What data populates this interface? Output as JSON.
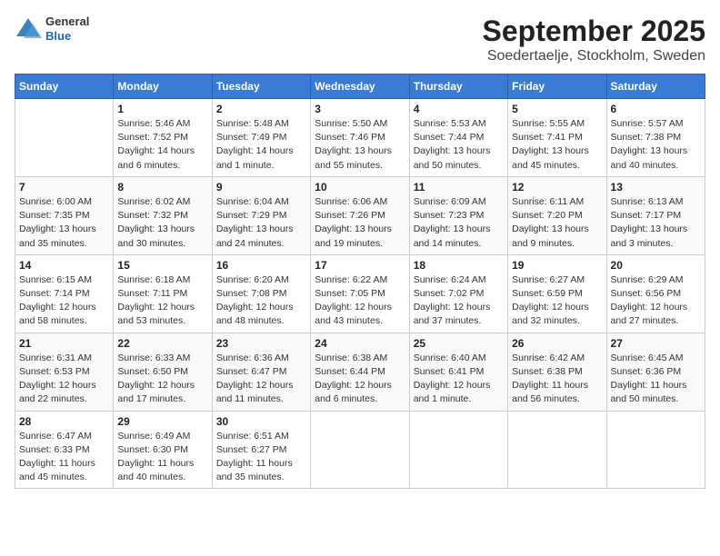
{
  "header": {
    "logo_line1": "General",
    "logo_line2": "Blue",
    "title": "September 2025",
    "subtitle": "Soedertaelje, Stockholm, Sweden"
  },
  "weekdays": [
    "Sunday",
    "Monday",
    "Tuesday",
    "Wednesday",
    "Thursday",
    "Friday",
    "Saturday"
  ],
  "weeks": [
    [
      {
        "day": "",
        "info": ""
      },
      {
        "day": "1",
        "info": "Sunrise: 5:46 AM\nSunset: 7:52 PM\nDaylight: 14 hours\nand 6 minutes."
      },
      {
        "day": "2",
        "info": "Sunrise: 5:48 AM\nSunset: 7:49 PM\nDaylight: 14 hours\nand 1 minute."
      },
      {
        "day": "3",
        "info": "Sunrise: 5:50 AM\nSunset: 7:46 PM\nDaylight: 13 hours\nand 55 minutes."
      },
      {
        "day": "4",
        "info": "Sunrise: 5:53 AM\nSunset: 7:44 PM\nDaylight: 13 hours\nand 50 minutes."
      },
      {
        "day": "5",
        "info": "Sunrise: 5:55 AM\nSunset: 7:41 PM\nDaylight: 13 hours\nand 45 minutes."
      },
      {
        "day": "6",
        "info": "Sunrise: 5:57 AM\nSunset: 7:38 PM\nDaylight: 13 hours\nand 40 minutes."
      }
    ],
    [
      {
        "day": "7",
        "info": "Sunrise: 6:00 AM\nSunset: 7:35 PM\nDaylight: 13 hours\nand 35 minutes."
      },
      {
        "day": "8",
        "info": "Sunrise: 6:02 AM\nSunset: 7:32 PM\nDaylight: 13 hours\nand 30 minutes."
      },
      {
        "day": "9",
        "info": "Sunrise: 6:04 AM\nSunset: 7:29 PM\nDaylight: 13 hours\nand 24 minutes."
      },
      {
        "day": "10",
        "info": "Sunrise: 6:06 AM\nSunset: 7:26 PM\nDaylight: 13 hours\nand 19 minutes."
      },
      {
        "day": "11",
        "info": "Sunrise: 6:09 AM\nSunset: 7:23 PM\nDaylight: 13 hours\nand 14 minutes."
      },
      {
        "day": "12",
        "info": "Sunrise: 6:11 AM\nSunset: 7:20 PM\nDaylight: 13 hours\nand 9 minutes."
      },
      {
        "day": "13",
        "info": "Sunrise: 6:13 AM\nSunset: 7:17 PM\nDaylight: 13 hours\nand 3 minutes."
      }
    ],
    [
      {
        "day": "14",
        "info": "Sunrise: 6:15 AM\nSunset: 7:14 PM\nDaylight: 12 hours\nand 58 minutes."
      },
      {
        "day": "15",
        "info": "Sunrise: 6:18 AM\nSunset: 7:11 PM\nDaylight: 12 hours\nand 53 minutes."
      },
      {
        "day": "16",
        "info": "Sunrise: 6:20 AM\nSunset: 7:08 PM\nDaylight: 12 hours\nand 48 minutes."
      },
      {
        "day": "17",
        "info": "Sunrise: 6:22 AM\nSunset: 7:05 PM\nDaylight: 12 hours\nand 43 minutes."
      },
      {
        "day": "18",
        "info": "Sunrise: 6:24 AM\nSunset: 7:02 PM\nDaylight: 12 hours\nand 37 minutes."
      },
      {
        "day": "19",
        "info": "Sunrise: 6:27 AM\nSunset: 6:59 PM\nDaylight: 12 hours\nand 32 minutes."
      },
      {
        "day": "20",
        "info": "Sunrise: 6:29 AM\nSunset: 6:56 PM\nDaylight: 12 hours\nand 27 minutes."
      }
    ],
    [
      {
        "day": "21",
        "info": "Sunrise: 6:31 AM\nSunset: 6:53 PM\nDaylight: 12 hours\nand 22 minutes."
      },
      {
        "day": "22",
        "info": "Sunrise: 6:33 AM\nSunset: 6:50 PM\nDaylight: 12 hours\nand 17 minutes."
      },
      {
        "day": "23",
        "info": "Sunrise: 6:36 AM\nSunset: 6:47 PM\nDaylight: 12 hours\nand 11 minutes."
      },
      {
        "day": "24",
        "info": "Sunrise: 6:38 AM\nSunset: 6:44 PM\nDaylight: 12 hours\nand 6 minutes."
      },
      {
        "day": "25",
        "info": "Sunrise: 6:40 AM\nSunset: 6:41 PM\nDaylight: 12 hours\nand 1 minute."
      },
      {
        "day": "26",
        "info": "Sunrise: 6:42 AM\nSunset: 6:38 PM\nDaylight: 11 hours\nand 56 minutes."
      },
      {
        "day": "27",
        "info": "Sunrise: 6:45 AM\nSunset: 6:36 PM\nDaylight: 11 hours\nand 50 minutes."
      }
    ],
    [
      {
        "day": "28",
        "info": "Sunrise: 6:47 AM\nSunset: 6:33 PM\nDaylight: 11 hours\nand 45 minutes."
      },
      {
        "day": "29",
        "info": "Sunrise: 6:49 AM\nSunset: 6:30 PM\nDaylight: 11 hours\nand 40 minutes."
      },
      {
        "day": "30",
        "info": "Sunrise: 6:51 AM\nSunset: 6:27 PM\nDaylight: 11 hours\nand 35 minutes."
      },
      {
        "day": "",
        "info": ""
      },
      {
        "day": "",
        "info": ""
      },
      {
        "day": "",
        "info": ""
      },
      {
        "day": "",
        "info": ""
      }
    ]
  ]
}
